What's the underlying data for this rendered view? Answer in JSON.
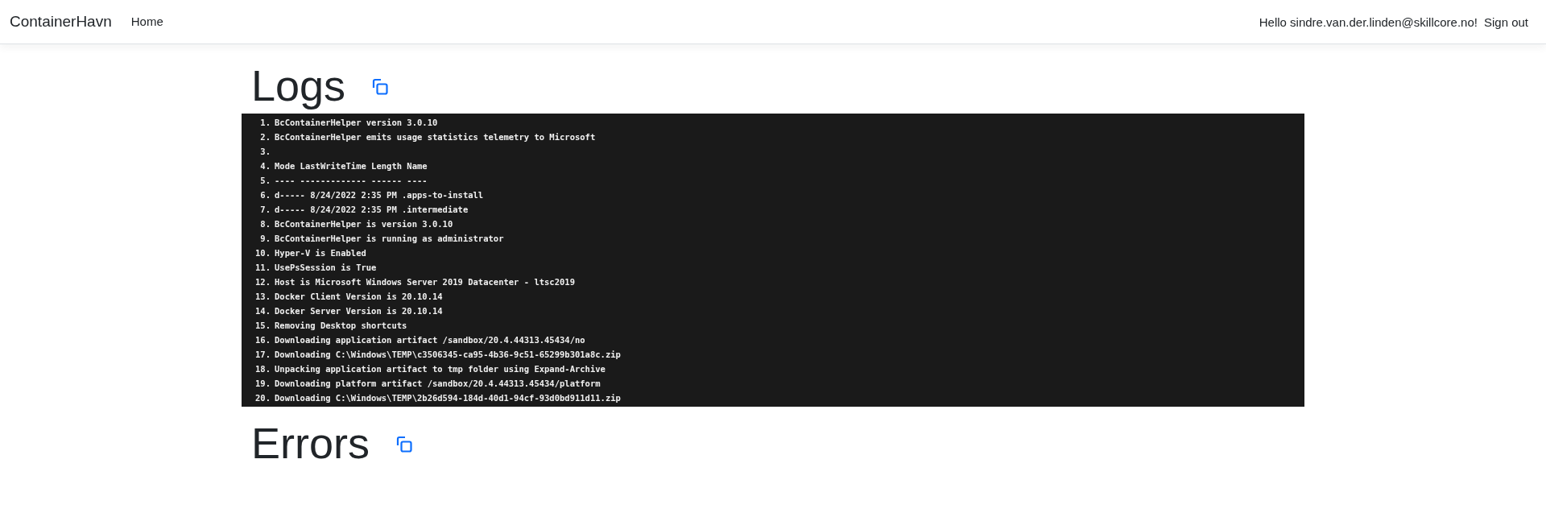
{
  "navbar": {
    "brand": "ContainerHavn",
    "links": [
      {
        "label": "Home"
      }
    ],
    "greeting": "Hello sindre.van.der.linden@skillcore.no!",
    "sign_out": "Sign out"
  },
  "sections": [
    {
      "title": "Logs",
      "lines": [
        {
          "number": "1.",
          "text": "BcContainerHelper version 3.0.10"
        },
        {
          "number": "2.",
          "text": "BcContainerHelper emits usage statistics telemetry to Microsoft"
        },
        {
          "number": "3."
        },
        {
          "number": "4.",
          "text": "Mode LastWriteTime Length Name"
        },
        {
          "number": "5.",
          "text": "---- ------------- ------ ----"
        },
        {
          "number": "6.",
          "text": "d----- 8/24/2022 2:35 PM .apps-to-install"
        },
        {
          "number": "7.",
          "text": "d----- 8/24/2022 2:35 PM .intermediate"
        },
        {
          "number": "8.",
          "text": "BcContainerHelper is version 3.0.10"
        },
        {
          "number": "9.",
          "text": "BcContainerHelper is running as administrator"
        },
        {
          "number": "10.",
          "text": "Hyper-V is Enabled"
        },
        {
          "number": "11.",
          "text": "UsePsSession is True"
        },
        {
          "number": "12.",
          "text": "Host is Microsoft Windows Server 2019 Datacenter - ltsc2019"
        },
        {
          "number": "13.",
          "text": "Docker Client Version is 20.10.14"
        },
        {
          "number": "14.",
          "text": "Docker Server Version is 20.10.14"
        },
        {
          "number": "15.",
          "text": "Removing Desktop shortcuts"
        },
        {
          "number": "16.",
          "text": "Downloading application artifact /sandbox/20.4.44313.45434/no"
        },
        {
          "number": "17.",
          "text": "Downloading C:\\Windows\\TEMP\\c3506345-ca95-4b36-9c51-65299b301a8c.zip"
        },
        {
          "number": "18.",
          "text": "Unpacking application artifact to tmp folder using Expand-Archive"
        },
        {
          "number": "19.",
          "text": "Downloading platform artifact /sandbox/20.4.44313.45434/platform"
        },
        {
          "number": "20.",
          "text": "Downloading C:\\Windows\\TEMP\\2b26d594-184d-40d1-94cf-93d0bd911d11.zip"
        }
      ]
    },
    {
      "title": "Errors"
    }
  ]
}
